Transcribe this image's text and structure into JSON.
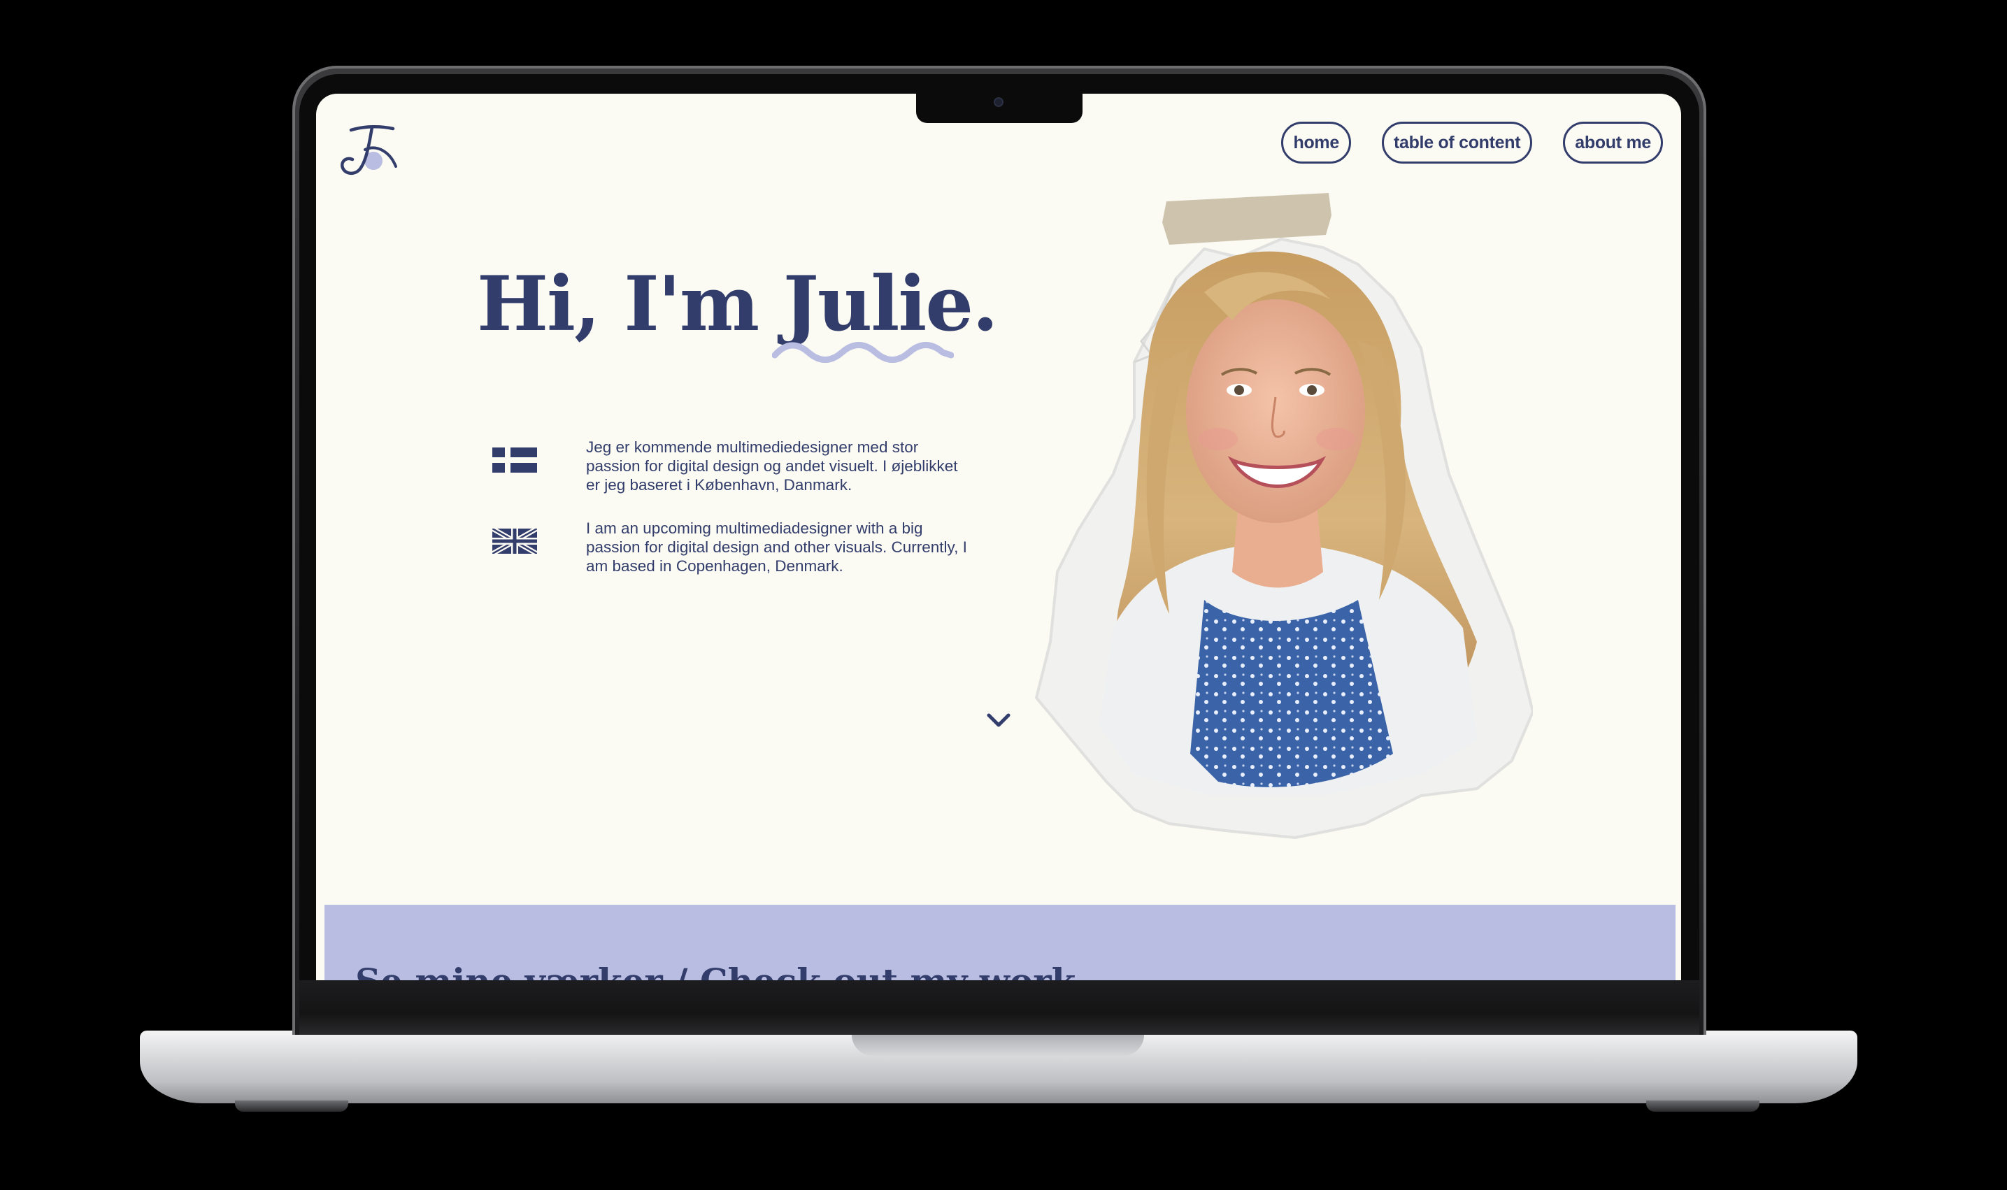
{
  "nav": {
    "home": "home",
    "toc": "table of content",
    "about": "about me"
  },
  "hero": {
    "greeting": "Hi, I'm Julie.",
    "danish_text": "Jeg er kommende multimediedesigner med stor passion for digital design og andet visuelt. I øjeblikket er jeg baseret i København, Danmark.",
    "english_text": "I am an upcoming multimediadesigner with a big passion for digital design and other visuals. Currently, I am based in Copenhagen, Denmark."
  },
  "work": {
    "heading": "Se mine værker / Check out my work"
  },
  "colors": {
    "navy": "#323d6b",
    "lavender": "#b8bde1",
    "cream": "#fbfaf3"
  },
  "icons": {
    "logo": "j-monogram-logo",
    "danish_flag": "danish-flag-icon",
    "uk_flag": "uk-flag-icon",
    "scroll": "chevron-down-icon"
  }
}
